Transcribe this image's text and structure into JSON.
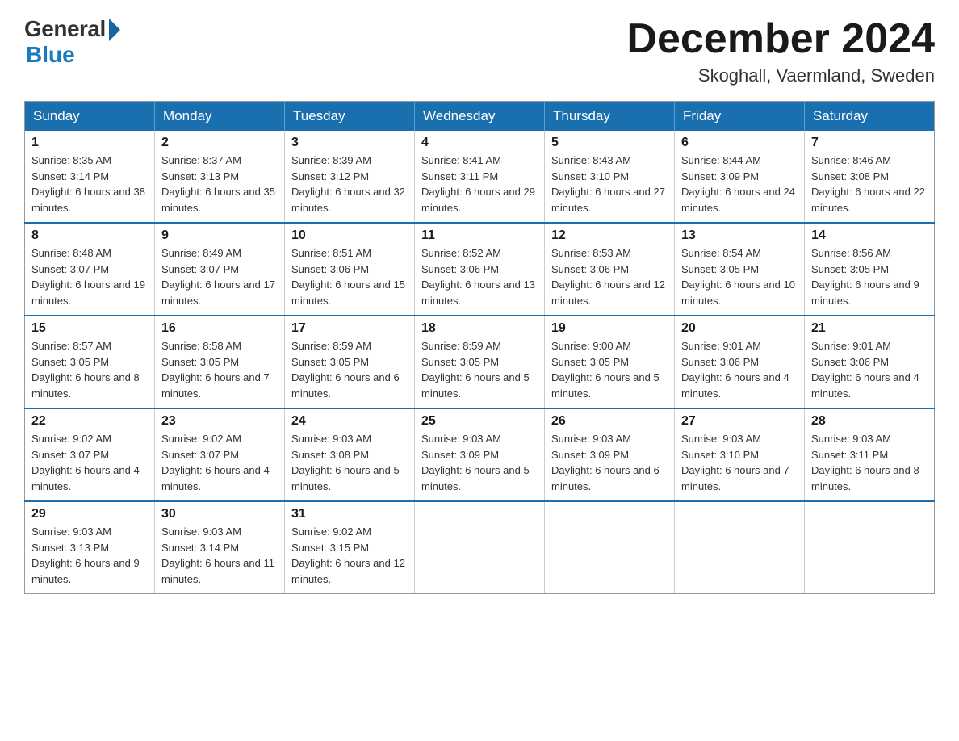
{
  "logo": {
    "general": "General",
    "blue": "Blue"
  },
  "title": {
    "month_year": "December 2024",
    "location": "Skoghall, Vaermland, Sweden"
  },
  "header_days": [
    "Sunday",
    "Monday",
    "Tuesday",
    "Wednesday",
    "Thursday",
    "Friday",
    "Saturday"
  ],
  "weeks": [
    [
      {
        "day": "1",
        "sunrise": "Sunrise: 8:35 AM",
        "sunset": "Sunset: 3:14 PM",
        "daylight": "Daylight: 6 hours and 38 minutes."
      },
      {
        "day": "2",
        "sunrise": "Sunrise: 8:37 AM",
        "sunset": "Sunset: 3:13 PM",
        "daylight": "Daylight: 6 hours and 35 minutes."
      },
      {
        "day": "3",
        "sunrise": "Sunrise: 8:39 AM",
        "sunset": "Sunset: 3:12 PM",
        "daylight": "Daylight: 6 hours and 32 minutes."
      },
      {
        "day": "4",
        "sunrise": "Sunrise: 8:41 AM",
        "sunset": "Sunset: 3:11 PM",
        "daylight": "Daylight: 6 hours and 29 minutes."
      },
      {
        "day": "5",
        "sunrise": "Sunrise: 8:43 AM",
        "sunset": "Sunset: 3:10 PM",
        "daylight": "Daylight: 6 hours and 27 minutes."
      },
      {
        "day": "6",
        "sunrise": "Sunrise: 8:44 AM",
        "sunset": "Sunset: 3:09 PM",
        "daylight": "Daylight: 6 hours and 24 minutes."
      },
      {
        "day": "7",
        "sunrise": "Sunrise: 8:46 AM",
        "sunset": "Sunset: 3:08 PM",
        "daylight": "Daylight: 6 hours and 22 minutes."
      }
    ],
    [
      {
        "day": "8",
        "sunrise": "Sunrise: 8:48 AM",
        "sunset": "Sunset: 3:07 PM",
        "daylight": "Daylight: 6 hours and 19 minutes."
      },
      {
        "day": "9",
        "sunrise": "Sunrise: 8:49 AM",
        "sunset": "Sunset: 3:07 PM",
        "daylight": "Daylight: 6 hours and 17 minutes."
      },
      {
        "day": "10",
        "sunrise": "Sunrise: 8:51 AM",
        "sunset": "Sunset: 3:06 PM",
        "daylight": "Daylight: 6 hours and 15 minutes."
      },
      {
        "day": "11",
        "sunrise": "Sunrise: 8:52 AM",
        "sunset": "Sunset: 3:06 PM",
        "daylight": "Daylight: 6 hours and 13 minutes."
      },
      {
        "day": "12",
        "sunrise": "Sunrise: 8:53 AM",
        "sunset": "Sunset: 3:06 PM",
        "daylight": "Daylight: 6 hours and 12 minutes."
      },
      {
        "day": "13",
        "sunrise": "Sunrise: 8:54 AM",
        "sunset": "Sunset: 3:05 PM",
        "daylight": "Daylight: 6 hours and 10 minutes."
      },
      {
        "day": "14",
        "sunrise": "Sunrise: 8:56 AM",
        "sunset": "Sunset: 3:05 PM",
        "daylight": "Daylight: 6 hours and 9 minutes."
      }
    ],
    [
      {
        "day": "15",
        "sunrise": "Sunrise: 8:57 AM",
        "sunset": "Sunset: 3:05 PM",
        "daylight": "Daylight: 6 hours and 8 minutes."
      },
      {
        "day": "16",
        "sunrise": "Sunrise: 8:58 AM",
        "sunset": "Sunset: 3:05 PM",
        "daylight": "Daylight: 6 hours and 7 minutes."
      },
      {
        "day": "17",
        "sunrise": "Sunrise: 8:59 AM",
        "sunset": "Sunset: 3:05 PM",
        "daylight": "Daylight: 6 hours and 6 minutes."
      },
      {
        "day": "18",
        "sunrise": "Sunrise: 8:59 AM",
        "sunset": "Sunset: 3:05 PM",
        "daylight": "Daylight: 6 hours and 5 minutes."
      },
      {
        "day": "19",
        "sunrise": "Sunrise: 9:00 AM",
        "sunset": "Sunset: 3:05 PM",
        "daylight": "Daylight: 6 hours and 5 minutes."
      },
      {
        "day": "20",
        "sunrise": "Sunrise: 9:01 AM",
        "sunset": "Sunset: 3:06 PM",
        "daylight": "Daylight: 6 hours and 4 minutes."
      },
      {
        "day": "21",
        "sunrise": "Sunrise: 9:01 AM",
        "sunset": "Sunset: 3:06 PM",
        "daylight": "Daylight: 6 hours and 4 minutes."
      }
    ],
    [
      {
        "day": "22",
        "sunrise": "Sunrise: 9:02 AM",
        "sunset": "Sunset: 3:07 PM",
        "daylight": "Daylight: 6 hours and 4 minutes."
      },
      {
        "day": "23",
        "sunrise": "Sunrise: 9:02 AM",
        "sunset": "Sunset: 3:07 PM",
        "daylight": "Daylight: 6 hours and 4 minutes."
      },
      {
        "day": "24",
        "sunrise": "Sunrise: 9:03 AM",
        "sunset": "Sunset: 3:08 PM",
        "daylight": "Daylight: 6 hours and 5 minutes."
      },
      {
        "day": "25",
        "sunrise": "Sunrise: 9:03 AM",
        "sunset": "Sunset: 3:09 PM",
        "daylight": "Daylight: 6 hours and 5 minutes."
      },
      {
        "day": "26",
        "sunrise": "Sunrise: 9:03 AM",
        "sunset": "Sunset: 3:09 PM",
        "daylight": "Daylight: 6 hours and 6 minutes."
      },
      {
        "day": "27",
        "sunrise": "Sunrise: 9:03 AM",
        "sunset": "Sunset: 3:10 PM",
        "daylight": "Daylight: 6 hours and 7 minutes."
      },
      {
        "day": "28",
        "sunrise": "Sunrise: 9:03 AM",
        "sunset": "Sunset: 3:11 PM",
        "daylight": "Daylight: 6 hours and 8 minutes."
      }
    ],
    [
      {
        "day": "29",
        "sunrise": "Sunrise: 9:03 AM",
        "sunset": "Sunset: 3:13 PM",
        "daylight": "Daylight: 6 hours and 9 minutes."
      },
      {
        "day": "30",
        "sunrise": "Sunrise: 9:03 AM",
        "sunset": "Sunset: 3:14 PM",
        "daylight": "Daylight: 6 hours and 11 minutes."
      },
      {
        "day": "31",
        "sunrise": "Sunrise: 9:02 AM",
        "sunset": "Sunset: 3:15 PM",
        "daylight": "Daylight: 6 hours and 12 minutes."
      },
      null,
      null,
      null,
      null
    ]
  ]
}
